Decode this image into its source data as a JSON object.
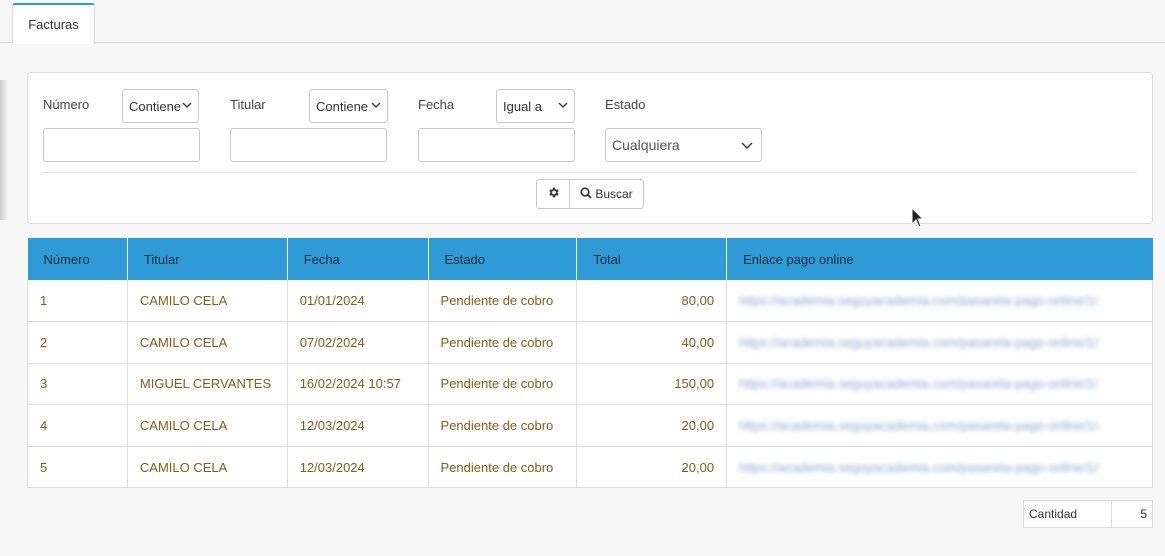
{
  "tabs": [
    {
      "label": "Facturas",
      "active": true
    }
  ],
  "filters": {
    "numero": {
      "label": "Número",
      "operator": "Contiene",
      "value": ""
    },
    "titular": {
      "label": "Titular",
      "operator": "Contiene",
      "value": ""
    },
    "fecha": {
      "label": "Fecha",
      "operator": "Igual a",
      "value": ""
    },
    "estado": {
      "label": "Estado",
      "selected": "Cualquiera"
    },
    "settings_icon": "gear-icon",
    "search_label": "Buscar",
    "search_icon": "search-icon"
  },
  "table": {
    "columns": [
      "Número",
      "Titular",
      "Fecha",
      "Estado",
      "Total",
      "Enlace pago online"
    ],
    "rows": [
      {
        "numero": "1",
        "titular": "CAMILO CELA",
        "fecha": "01/01/2024",
        "estado": "Pendiente de cobro",
        "total": "80,00",
        "enlace": "https://academia.seguyacademia.com/pasarela-pago-online/1/1"
      },
      {
        "numero": "2",
        "titular": "CAMILO CELA",
        "fecha": "07/02/2024",
        "estado": "Pendiente de cobro",
        "total": "40,00",
        "enlace": "https://academia.seguyacademia.com/pasarela-pago-online/1/2"
      },
      {
        "numero": "3",
        "titular": "MIGUEL CERVANTES",
        "fecha": "16/02/2024 10:57",
        "estado": "Pendiente de cobro",
        "total": "150,00",
        "enlace": "https://academia.seguyacademia.com/pasarela-pago-online/1/3"
      },
      {
        "numero": "4",
        "titular": "CAMILO CELA",
        "fecha": "12/03/2024",
        "estado": "Pendiente de cobro",
        "total": "20,00",
        "enlace": "https://academia.seguyacademia.com/pasarela-pago-online/1/4"
      },
      {
        "numero": "5",
        "titular": "CAMILO CELA",
        "fecha": "12/03/2024",
        "estado": "Pendiente de cobro",
        "total": "20,00",
        "enlace": "https://academia.seguyacademia.com/pasarela-pago-online/1/5"
      }
    ]
  },
  "footer": {
    "count_label": "Cantidad",
    "count_value": "5"
  },
  "colors": {
    "accent": "#2e9ad6",
    "cell_text": "#8a5a17"
  }
}
